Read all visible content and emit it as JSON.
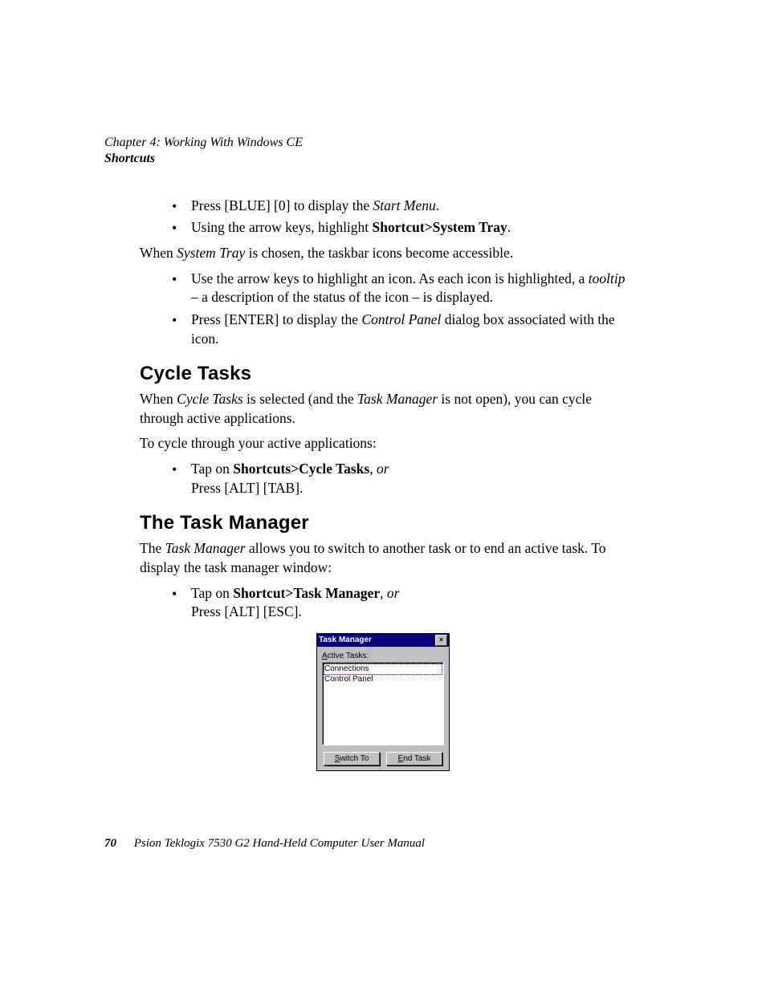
{
  "header": {
    "chapter": "Chapter 4: Working With Windows CE",
    "section": "Shortcuts"
  },
  "list1": {
    "item1": {
      "pre": "Press [BLUE] [0] to display the ",
      "em": "Start Menu",
      "post": "."
    },
    "item2": {
      "pre": "Using the arrow keys, highlight ",
      "bold": "Shortcut>System Tray",
      "post": "."
    }
  },
  "para1": {
    "pre": "When ",
    "em": "System Tray",
    "post": " is chosen, the taskbar icons become accessible."
  },
  "list2": {
    "item1": {
      "line1": "Use the arrow keys to highlight an icon. As each icon is highlighted, a ",
      "em": "tooltip",
      "line2": " – a description of the status of the icon – is displayed."
    },
    "item2": {
      "pre": "Press [ENTER] to display the ",
      "em": "Control Panel",
      "post": " dialog box associated with the icon."
    }
  },
  "cycle": {
    "heading": "Cycle Tasks",
    "p1": {
      "pre": "When ",
      "em1": "Cycle Tasks",
      "mid": " is selected (and the ",
      "em2": "Task Manager",
      "post": " is not open), you can cycle through active applications."
    },
    "p2": "To cycle through your active applications:",
    "li": {
      "pre": "Tap on ",
      "bold": "Shortcuts>Cycle Tasks",
      "post1": ", ",
      "or": "or",
      "line2": "Press [ALT] [TAB]."
    }
  },
  "tm": {
    "heading": "The Task Manager",
    "p1": {
      "pre": "The ",
      "em": "Task Manager",
      "post": " allows you to switch to another task or to end an active task. To display the task manager window:"
    },
    "li": {
      "pre": "Tap on ",
      "bold": "Shortcut>Task Manager",
      "post1": ", ",
      "or": "or",
      "line2": "Press [ALT] [ESC]."
    }
  },
  "window": {
    "title": "Task Manager",
    "label_pre": "A",
    "label_post": "ctive Tasks:",
    "items": [
      "Connections",
      "Control Panel"
    ],
    "switch_pre": "S",
    "switch_post": "witch To",
    "end_pre": "E",
    "end_post": "nd Task"
  },
  "footer": {
    "page": "70",
    "title": "Psion Teklogix 7530 G2 Hand-Held Computer User Manual"
  }
}
